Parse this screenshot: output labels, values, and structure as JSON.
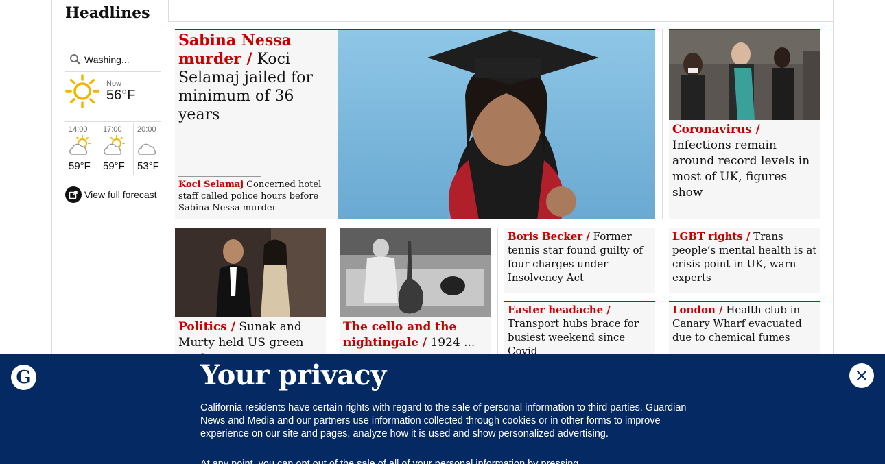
{
  "section": {
    "title": "Headlines"
  },
  "weather": {
    "location": "Washing...",
    "now_label": "Now",
    "now_temp": "56°F",
    "now_icon": "sun-icon",
    "hourly": [
      {
        "time": "14:00",
        "temp": "59°F",
        "icon": "sun-cloud-icon"
      },
      {
        "time": "17:00",
        "temp": "59°F",
        "icon": "sun-cloud-icon"
      },
      {
        "time": "20:00",
        "temp": "53°F",
        "icon": "cloud-icon"
      }
    ],
    "forecast_label": "View full forecast"
  },
  "stories": {
    "main": {
      "kicker": "Sabina Nessa murder /",
      "headline": " Koci Selamaj jailed for minimum of 36 years",
      "sub_kicker": "Koci Selamaj",
      "sub_headline": " Concerned hotel staff called police hours before Sabina Nessa murder"
    },
    "corona": {
      "kicker": "Coronavirus /",
      "headline": " Infections remain around record levels in most of UK, figures show"
    },
    "sunak": {
      "kicker": "Politics /",
      "headline": " Sunak and Murty held US green card"
    },
    "cello": {
      "kicker": "The cello and the nightingale /",
      "headline": " 1924 ..."
    },
    "becker": {
      "kicker": "Boris Becker  /",
      "headline": " Former tennis star found guilty of four charges under Insolvency Act"
    },
    "lgbt": {
      "kicker": "LGBT rights /",
      "headline": " Trans people’s mental health is at crisis point in UK, warn experts"
    },
    "easter": {
      "kicker": "Easter headache /",
      "headline": " Transport hubs brace for busiest weekend since Covid"
    },
    "london": {
      "kicker": "London /",
      "headline": " Health club in Canary Wharf evacuated due to chemical fumes"
    }
  },
  "privacy": {
    "logo_letter": "G",
    "title": "Your privacy",
    "body": "California residents have certain rights with regard to the sale of personal information to third parties. Guardian News and Media and our partners use information collected through cookies or in other forms to improve experience on our site and pages, analyze how it is used and show personalized advertising.",
    "body_cut": "At any point, you can opt out of the sale of all of your personal information by pressing",
    "close_icon": "close-icon"
  },
  "colors": {
    "accent": "#c70000",
    "banner_bg": "#052962",
    "card_bg": "#f6f6f6"
  }
}
